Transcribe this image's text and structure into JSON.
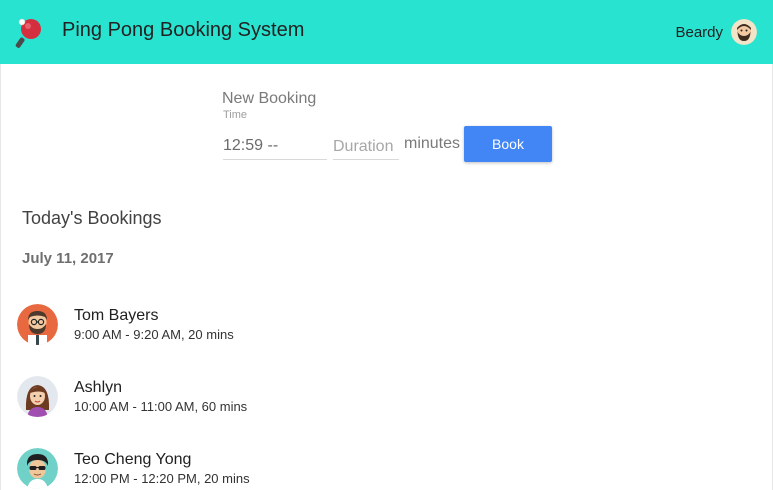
{
  "header": {
    "title": "Ping Pong Booking System",
    "logo_icon": "ping-pong-paddle-icon",
    "user_name": "Beardy",
    "user_avatar_icon": "bearded-man-avatar-icon",
    "background_color": "#29e3d1"
  },
  "new_booking": {
    "title": "New Booking",
    "time_label": "Time",
    "time_value": "12:59 --",
    "duration_placeholder": "Duration",
    "duration_unit": "minutes",
    "book_label": "Book",
    "book_color": "#4285f4"
  },
  "bookings_section": {
    "heading": "Today's Bookings",
    "date": "July 11, 2017",
    "items": [
      {
        "name": "Tom Bayers",
        "time": "9:00 AM - 9:20 AM, 20 mins",
        "avatar": "bearded-man-glasses-avatar-icon"
      },
      {
        "name": "Ashlyn",
        "time": "10:00 AM - 11:00 AM, 60 mins",
        "avatar": "woman-avatar-icon"
      },
      {
        "name": "Teo Cheng Yong",
        "time": "12:00 PM - 12:20 PM, 20 mins",
        "avatar": "man-sunglasses-avatar-icon"
      }
    ]
  }
}
